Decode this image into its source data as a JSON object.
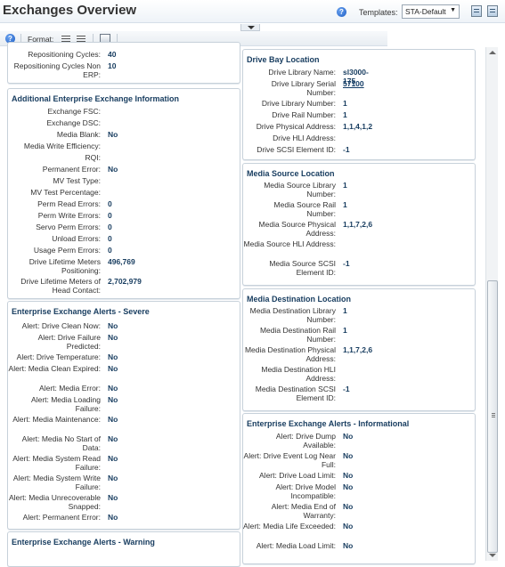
{
  "header": {
    "title": "Exchanges Overview",
    "templates_label": "Templates:",
    "template_value": "STA-Default"
  },
  "format_bar": {
    "format_label": "Format:"
  },
  "left": {
    "top": [
      {
        "label": "Repositioning Cycles:",
        "value": "40"
      },
      {
        "label": "Repositioning Cycles Non ERP:",
        "value": "10"
      }
    ],
    "additional": {
      "title": "Additional Enterprise Exchange Information",
      "rows": [
        {
          "label": "Exchange FSC:",
          "value": ""
        },
        {
          "label": "Exchange DSC:",
          "value": ""
        },
        {
          "label": "Media Blank:",
          "value": "No"
        },
        {
          "label": "Media Write Efficiency:",
          "value": ""
        },
        {
          "label": "RQI:",
          "value": ""
        },
        {
          "label": "Permanent Error:",
          "value": "No"
        },
        {
          "label": "MV Test Type:",
          "value": ""
        },
        {
          "label": "MV Test Percentage:",
          "value": ""
        },
        {
          "label": "Perm Read Errors:",
          "value": "0"
        },
        {
          "label": "Perm Write Errors:",
          "value": "0"
        },
        {
          "label": "Servo Perm Errors:",
          "value": "0"
        },
        {
          "label": "Unload Errors:",
          "value": "0"
        },
        {
          "label": "Usage Perm Errors:",
          "value": "0"
        },
        {
          "label": "Drive Lifetime Meters Positioning:",
          "value": "496,769"
        },
        {
          "label": "Drive Lifetime Meters of Head Contact:",
          "value": "2,702,979"
        }
      ]
    },
    "severe": {
      "title": "Enterprise Exchange Alerts - Severe",
      "rows": [
        {
          "label": "Alert: Drive Clean Now:",
          "value": "No"
        },
        {
          "label": "Alert: Drive Failure Predicted:",
          "value": "No"
        },
        {
          "label": "Alert: Drive Temperature:",
          "value": "No"
        },
        {
          "label": "Alert: Media Clean Expired:",
          "value": "No"
        },
        {
          "label": "Alert: Media Error:",
          "value": "No"
        },
        {
          "label": "Alert: Media Loading Failure:",
          "value": "No"
        },
        {
          "label": "Alert: Media Maintenance:",
          "value": "No"
        },
        {
          "label": "Alert: Media No Start of Data:",
          "value": "No"
        },
        {
          "label": "Alert: Media System Read Failure:",
          "value": "No"
        },
        {
          "label": "Alert: Media System Write Failure:",
          "value": "No"
        },
        {
          "label": "Alert: Media Unrecoverable Snapped:",
          "value": "No"
        },
        {
          "label": "Alert: Permanent Error:",
          "value": "No"
        }
      ]
    },
    "warning": {
      "title": "Enterprise Exchange Alerts - Warning"
    }
  },
  "right": {
    "drive_bay": {
      "title": "Drive Bay Location",
      "rows": [
        {
          "label": "Drive Library Name:",
          "value": "sl3000-175"
        },
        {
          "label": "Drive Library Serial Number:",
          "value": "57100"
        },
        {
          "label": "Drive Library Number:",
          "value": "1"
        },
        {
          "label": "Drive Rail Number:",
          "value": "1"
        },
        {
          "label": "Drive Physical Address:",
          "value": "1,1,4,1,2"
        },
        {
          "label": "Drive HLI Address:",
          "value": ""
        },
        {
          "label": "Drive SCSI Element ID:",
          "value": "-1"
        }
      ]
    },
    "media_source": {
      "title": "Media Source Location",
      "rows": [
        {
          "label": "Media Source Library Number:",
          "value": "1"
        },
        {
          "label": "Media Source Rail Number:",
          "value": "1"
        },
        {
          "label": "Media Source Physical Address:",
          "value": "1,1,7,2,6"
        },
        {
          "label": "Media Source HLI Address:",
          "value": ""
        },
        {
          "label": "Media Source SCSI Element ID:",
          "value": "-1"
        }
      ]
    },
    "media_dest": {
      "title": "Media Destination Location",
      "rows": [
        {
          "label": "Media Destination Library Number:",
          "value": "1"
        },
        {
          "label": "Media Destination Rail Number:",
          "value": "1"
        },
        {
          "label": "Media Destination Physical Address:",
          "value": "1,1,7,2,6"
        },
        {
          "label": "Media Destination HLI Address:",
          "value": ""
        },
        {
          "label": "Media Destination SCSI Element ID:",
          "value": "-1"
        }
      ]
    },
    "informational": {
      "title": "Enterprise Exchange Alerts - Informational",
      "rows": [
        {
          "label": "Alert: Drive Dump Available:",
          "value": "No"
        },
        {
          "label": "Alert: Drive Event Log Near Full:",
          "value": "No"
        },
        {
          "label": "Alert: Drive Load Limit:",
          "value": "No"
        },
        {
          "label": "Alert: Drive Model Incompatible:",
          "value": "No"
        },
        {
          "label": "Alert: Media End of Warranty:",
          "value": "No"
        },
        {
          "label": "Alert: Media Life Exceeded:",
          "value": "No"
        },
        {
          "label": "Alert: Media Load Limit:",
          "value": "No"
        }
      ]
    }
  }
}
